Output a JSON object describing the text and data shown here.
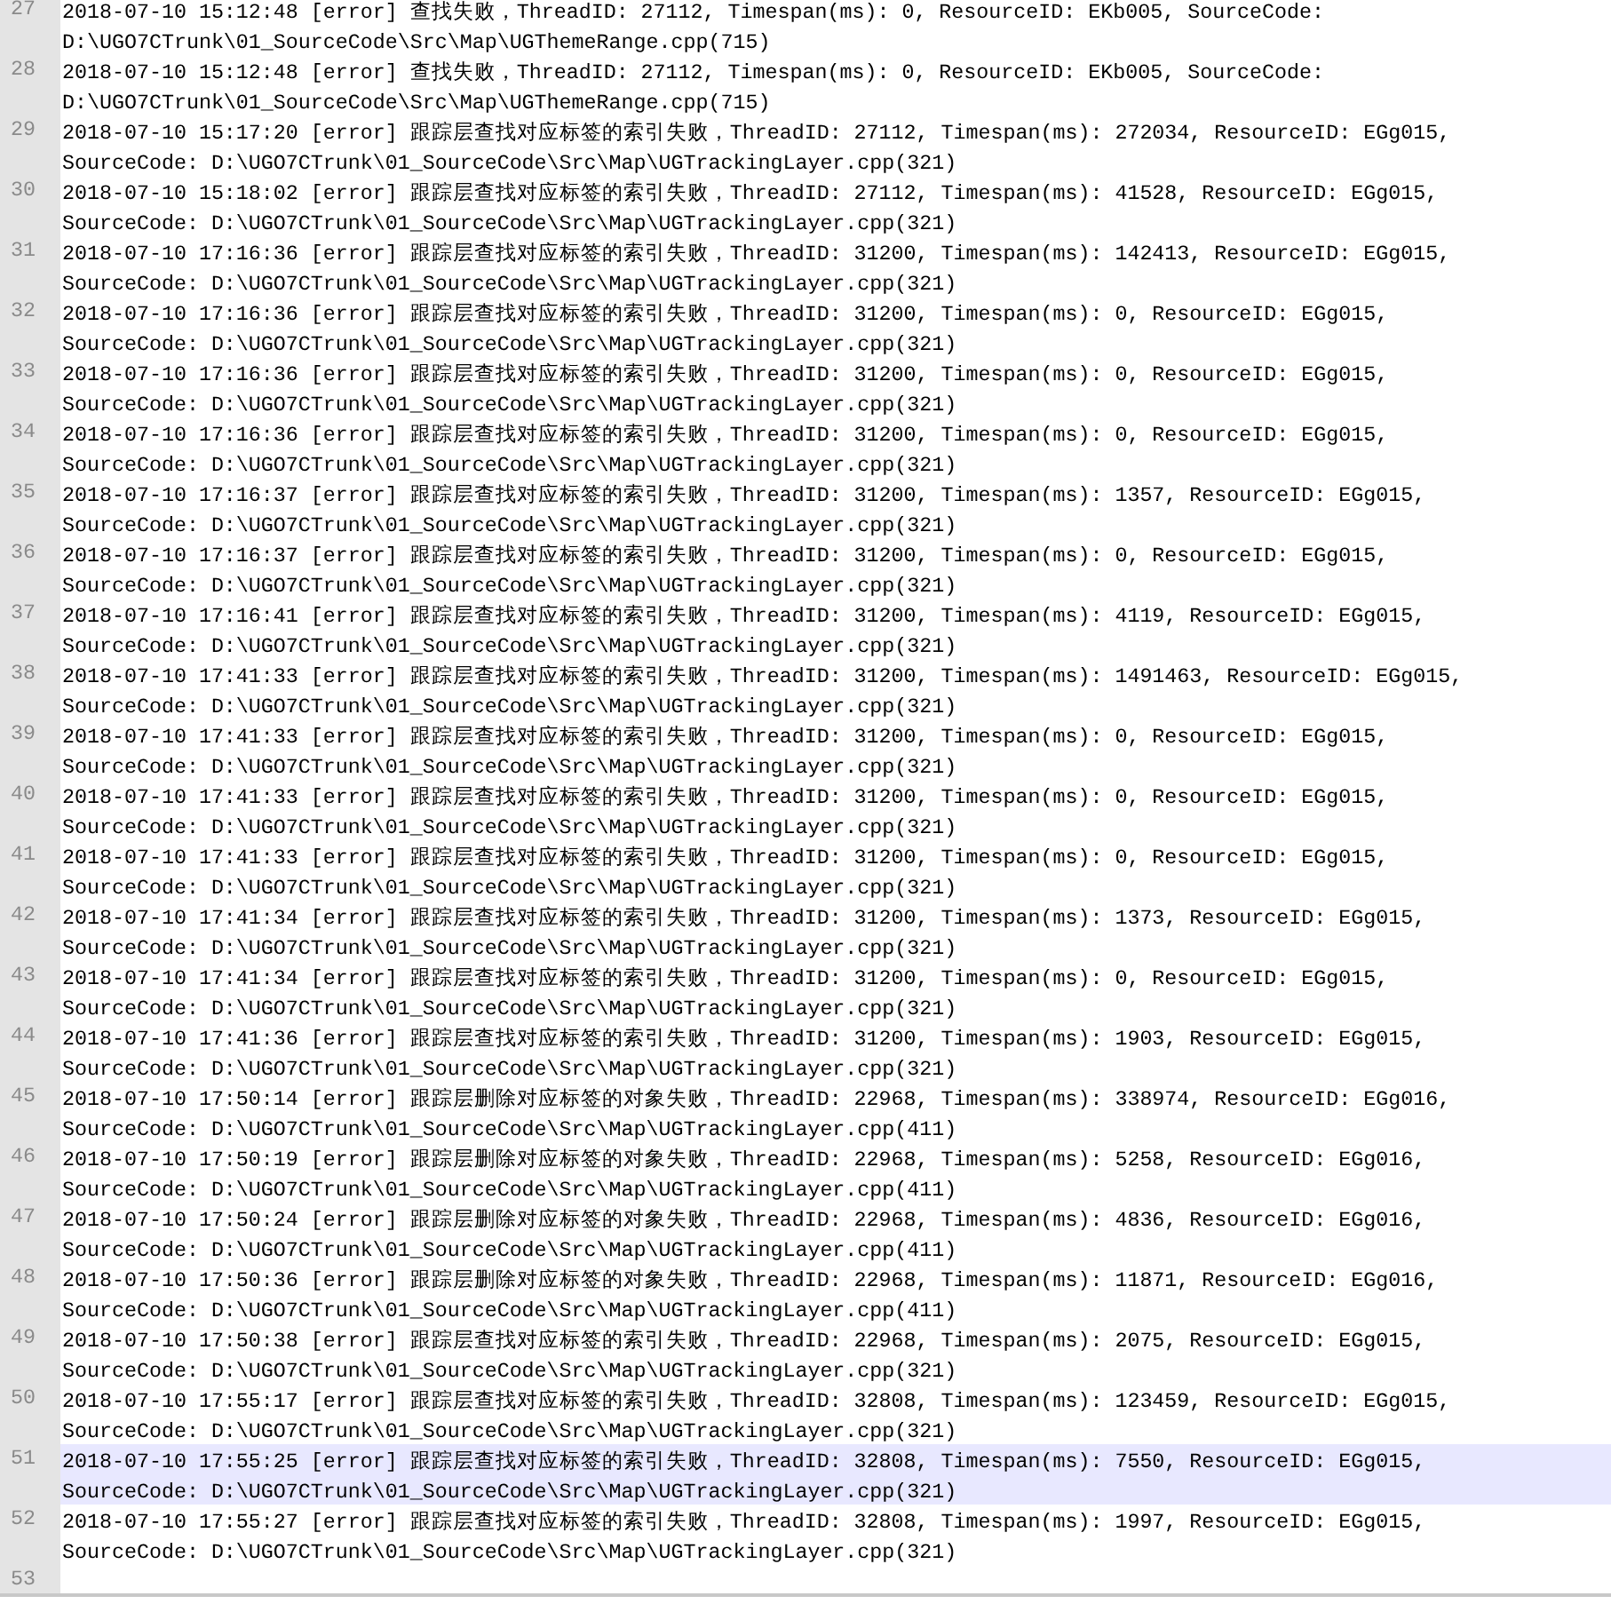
{
  "editor": {
    "lines": [
      {
        "number": "27",
        "selected": false,
        "rows": [
          "2018-07-10 15:12:48 [error] 查找失败，ThreadID: 27112, Timespan(ms): 0, ResourceID: EKb005, SourceCode:",
          "D:\\UGO7CTrunk\\01_SourceCode\\Src\\Map\\UGThemeRange.cpp(715)"
        ]
      },
      {
        "number": "28",
        "selected": false,
        "rows": [
          "2018-07-10 15:12:48 [error] 查找失败，ThreadID: 27112, Timespan(ms): 0, ResourceID: EKb005, SourceCode:",
          "D:\\UGO7CTrunk\\01_SourceCode\\Src\\Map\\UGThemeRange.cpp(715)"
        ]
      },
      {
        "number": "29",
        "selected": false,
        "rows": [
          "2018-07-10 15:17:20 [error] 跟踪层查找对应标签的索引失败，ThreadID: 27112, Timespan(ms): 272034, ResourceID: EGg015,",
          "SourceCode: D:\\UGO7CTrunk\\01_SourceCode\\Src\\Map\\UGTrackingLayer.cpp(321)"
        ]
      },
      {
        "number": "30",
        "selected": false,
        "rows": [
          "2018-07-10 15:18:02 [error] 跟踪层查找对应标签的索引失败，ThreadID: 27112, Timespan(ms): 41528, ResourceID: EGg015,",
          "SourceCode: D:\\UGO7CTrunk\\01_SourceCode\\Src\\Map\\UGTrackingLayer.cpp(321)"
        ]
      },
      {
        "number": "31",
        "selected": false,
        "rows": [
          "2018-07-10 17:16:36 [error] 跟踪层查找对应标签的索引失败，ThreadID: 31200, Timespan(ms): 142413, ResourceID: EGg015,",
          "SourceCode: D:\\UGO7CTrunk\\01_SourceCode\\Src\\Map\\UGTrackingLayer.cpp(321)"
        ]
      },
      {
        "number": "32",
        "selected": false,
        "rows": [
          "2018-07-10 17:16:36 [error] 跟踪层查找对应标签的索引失败，ThreadID: 31200, Timespan(ms): 0, ResourceID: EGg015,",
          "SourceCode: D:\\UGO7CTrunk\\01_SourceCode\\Src\\Map\\UGTrackingLayer.cpp(321)"
        ]
      },
      {
        "number": "33",
        "selected": false,
        "rows": [
          "2018-07-10 17:16:36 [error] 跟踪层查找对应标签的索引失败，ThreadID: 31200, Timespan(ms): 0, ResourceID: EGg015,",
          "SourceCode: D:\\UGO7CTrunk\\01_SourceCode\\Src\\Map\\UGTrackingLayer.cpp(321)"
        ]
      },
      {
        "number": "34",
        "selected": false,
        "rows": [
          "2018-07-10 17:16:36 [error] 跟踪层查找对应标签的索引失败，ThreadID: 31200, Timespan(ms): 0, ResourceID: EGg015,",
          "SourceCode: D:\\UGO7CTrunk\\01_SourceCode\\Src\\Map\\UGTrackingLayer.cpp(321)"
        ]
      },
      {
        "number": "35",
        "selected": false,
        "rows": [
          "2018-07-10 17:16:37 [error] 跟踪层查找对应标签的索引失败，ThreadID: 31200, Timespan(ms): 1357, ResourceID: EGg015,",
          "SourceCode: D:\\UGO7CTrunk\\01_SourceCode\\Src\\Map\\UGTrackingLayer.cpp(321)"
        ]
      },
      {
        "number": "36",
        "selected": false,
        "rows": [
          "2018-07-10 17:16:37 [error] 跟踪层查找对应标签的索引失败，ThreadID: 31200, Timespan(ms): 0, ResourceID: EGg015,",
          "SourceCode: D:\\UGO7CTrunk\\01_SourceCode\\Src\\Map\\UGTrackingLayer.cpp(321)"
        ]
      },
      {
        "number": "37",
        "selected": false,
        "rows": [
          "2018-07-10 17:16:41 [error] 跟踪层查找对应标签的索引失败，ThreadID: 31200, Timespan(ms): 4119, ResourceID: EGg015,",
          "SourceCode: D:\\UGO7CTrunk\\01_SourceCode\\Src\\Map\\UGTrackingLayer.cpp(321)"
        ]
      },
      {
        "number": "38",
        "selected": false,
        "rows": [
          "2018-07-10 17:41:33 [error] 跟踪层查找对应标签的索引失败，ThreadID: 31200, Timespan(ms): 1491463, ResourceID: EGg015,",
          "SourceCode: D:\\UGO7CTrunk\\01_SourceCode\\Src\\Map\\UGTrackingLayer.cpp(321)"
        ]
      },
      {
        "number": "39",
        "selected": false,
        "rows": [
          "2018-07-10 17:41:33 [error] 跟踪层查找对应标签的索引失败，ThreadID: 31200, Timespan(ms): 0, ResourceID: EGg015,",
          "SourceCode: D:\\UGO7CTrunk\\01_SourceCode\\Src\\Map\\UGTrackingLayer.cpp(321)"
        ]
      },
      {
        "number": "40",
        "selected": false,
        "rows": [
          "2018-07-10 17:41:33 [error] 跟踪层查找对应标签的索引失败，ThreadID: 31200, Timespan(ms): 0, ResourceID: EGg015,",
          "SourceCode: D:\\UGO7CTrunk\\01_SourceCode\\Src\\Map\\UGTrackingLayer.cpp(321)"
        ]
      },
      {
        "number": "41",
        "selected": false,
        "rows": [
          "2018-07-10 17:41:33 [error] 跟踪层查找对应标签的索引失败，ThreadID: 31200, Timespan(ms): 0, ResourceID: EGg015,",
          "SourceCode: D:\\UGO7CTrunk\\01_SourceCode\\Src\\Map\\UGTrackingLayer.cpp(321)"
        ]
      },
      {
        "number": "42",
        "selected": false,
        "rows": [
          "2018-07-10 17:41:34 [error] 跟踪层查找对应标签的索引失败，ThreadID: 31200, Timespan(ms): 1373, ResourceID: EGg015,",
          "SourceCode: D:\\UGO7CTrunk\\01_SourceCode\\Src\\Map\\UGTrackingLayer.cpp(321)"
        ]
      },
      {
        "number": "43",
        "selected": false,
        "rows": [
          "2018-07-10 17:41:34 [error] 跟踪层查找对应标签的索引失败，ThreadID: 31200, Timespan(ms): 0, ResourceID: EGg015,",
          "SourceCode: D:\\UGO7CTrunk\\01_SourceCode\\Src\\Map\\UGTrackingLayer.cpp(321)"
        ]
      },
      {
        "number": "44",
        "selected": false,
        "rows": [
          "2018-07-10 17:41:36 [error] 跟踪层查找对应标签的索引失败，ThreadID: 31200, Timespan(ms): 1903, ResourceID: EGg015,",
          "SourceCode: D:\\UGO7CTrunk\\01_SourceCode\\Src\\Map\\UGTrackingLayer.cpp(321)"
        ]
      },
      {
        "number": "45",
        "selected": false,
        "rows": [
          "2018-07-10 17:50:14 [error] 跟踪层删除对应标签的对象失败，ThreadID: 22968, Timespan(ms): 338974, ResourceID: EGg016,",
          "SourceCode: D:\\UGO7CTrunk\\01_SourceCode\\Src\\Map\\UGTrackingLayer.cpp(411)"
        ]
      },
      {
        "number": "46",
        "selected": false,
        "rows": [
          "2018-07-10 17:50:19 [error] 跟踪层删除对应标签的对象失败，ThreadID: 22968, Timespan(ms): 5258, ResourceID: EGg016,",
          "SourceCode: D:\\UGO7CTrunk\\01_SourceCode\\Src\\Map\\UGTrackingLayer.cpp(411)"
        ]
      },
      {
        "number": "47",
        "selected": false,
        "rows": [
          "2018-07-10 17:50:24 [error] 跟踪层删除对应标签的对象失败，ThreadID: 22968, Timespan(ms): 4836, ResourceID: EGg016,",
          "SourceCode: D:\\UGO7CTrunk\\01_SourceCode\\Src\\Map\\UGTrackingLayer.cpp(411)"
        ]
      },
      {
        "number": "48",
        "selected": false,
        "rows": [
          "2018-07-10 17:50:36 [error] 跟踪层删除对应标签的对象失败，ThreadID: 22968, Timespan(ms): 11871, ResourceID: EGg016,",
          "SourceCode: D:\\UGO7CTrunk\\01_SourceCode\\Src\\Map\\UGTrackingLayer.cpp(411)"
        ]
      },
      {
        "number": "49",
        "selected": false,
        "rows": [
          "2018-07-10 17:50:38 [error] 跟踪层查找对应标签的索引失败，ThreadID: 22968, Timespan(ms): 2075, ResourceID: EGg015,",
          "SourceCode: D:\\UGO7CTrunk\\01_SourceCode\\Src\\Map\\UGTrackingLayer.cpp(321)"
        ]
      },
      {
        "number": "50",
        "selected": false,
        "rows": [
          "2018-07-10 17:55:17 [error] 跟踪层查找对应标签的索引失败，ThreadID: 32808, Timespan(ms): 123459, ResourceID: EGg015,",
          "SourceCode: D:\\UGO7CTrunk\\01_SourceCode\\Src\\Map\\UGTrackingLayer.cpp(321)"
        ]
      },
      {
        "number": "51",
        "selected": true,
        "rows": [
          "2018-07-10 17:55:25 [error] 跟踪层查找对应标签的索引失败，ThreadID: 32808, Timespan(ms): 7550, ResourceID: EGg015,",
          "SourceCode: D:\\UGO7CTrunk\\01_SourceCode\\Src\\Map\\UGTrackingLayer.cpp(321)"
        ]
      },
      {
        "number": "52",
        "selected": false,
        "rows": [
          "2018-07-10 17:55:27 [error] 跟踪层查找对应标签的索引失败，ThreadID: 32808, Timespan(ms): 1997, ResourceID: EGg015,",
          "SourceCode: D:\\UGO7CTrunk\\01_SourceCode\\Src\\Map\\UGTrackingLayer.cpp(321)"
        ]
      },
      {
        "number": "53",
        "selected": false
      }
    ]
  }
}
